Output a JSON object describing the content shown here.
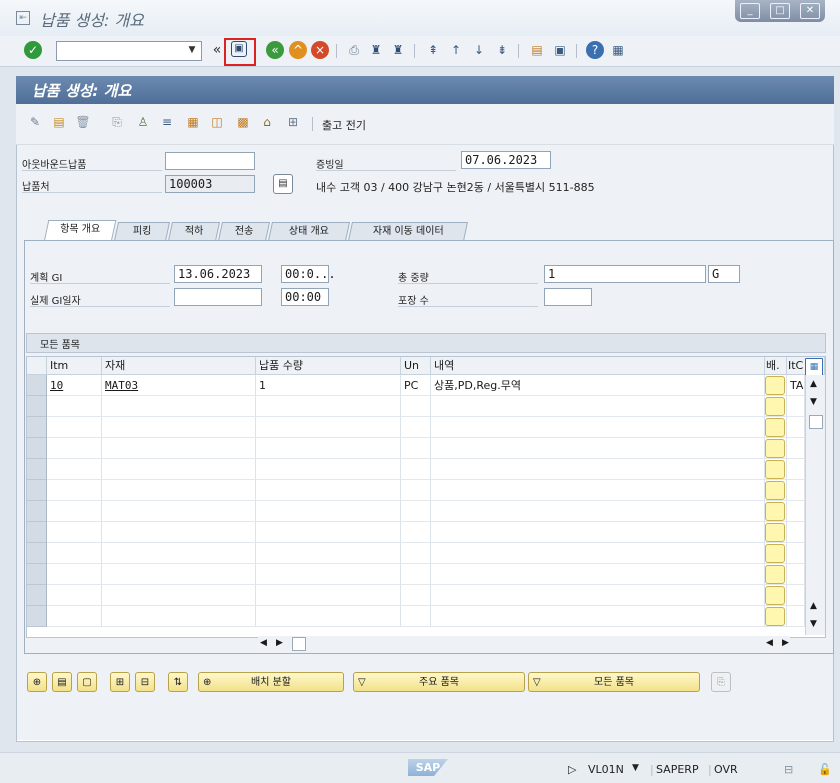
{
  "window": {
    "title": "납품 생성: 개요"
  },
  "toolbar": {
    "command_value": "",
    "save_tooltip": "Save"
  },
  "panel": {
    "title": "납품 생성: 개요",
    "output_label": "출고 전기"
  },
  "header": {
    "outbound_label": "아웃바운드납품",
    "outbound_value": "",
    "shipto_label": "납품처",
    "shipto_value": "100003",
    "docdate_label": "증빙일",
    "docdate_value": "07.06.2023",
    "address": "내수 고객 03 / 400 강남구 논현2동 / 서울특별시 511-885"
  },
  "tabs": [
    {
      "label": "항목 개요",
      "active": true
    },
    {
      "label": "피킹"
    },
    {
      "label": "적하"
    },
    {
      "label": "전송"
    },
    {
      "label": "상태 개요"
    },
    {
      "label": "자재 이동 데이터"
    }
  ],
  "overview": {
    "planned_gi_label": "계획 GI",
    "planned_gi_date": "13.06.2023",
    "planned_gi_time": "00:0...",
    "actual_gi_label": "실제 GI일자",
    "actual_gi_date": "",
    "actual_gi_time": "00:00",
    "total_weight_label": "총 중량",
    "total_weight_value": "1",
    "weight_unit": "G",
    "packages_label": "포장 수",
    "packages_value": ""
  },
  "grid": {
    "title": "모든 품목",
    "columns": [
      "Itm",
      "자재",
      "납품 수량",
      "Un",
      "내역",
      "배.",
      "ItC"
    ],
    "rows": [
      {
        "item": "10",
        "material": "MAT03",
        "qty": "1",
        "unit": "PC",
        "desc": "상품,PD,Reg.무역",
        "itc": "TA"
      }
    ]
  },
  "buttons": {
    "batch_split": "배치 분할",
    "main_items": "주요 품목",
    "all_items": "모든 품목"
  },
  "status": {
    "tcode": "VL01N",
    "system": "SAPERP",
    "mode": "OVR",
    "logo": "SAP"
  }
}
